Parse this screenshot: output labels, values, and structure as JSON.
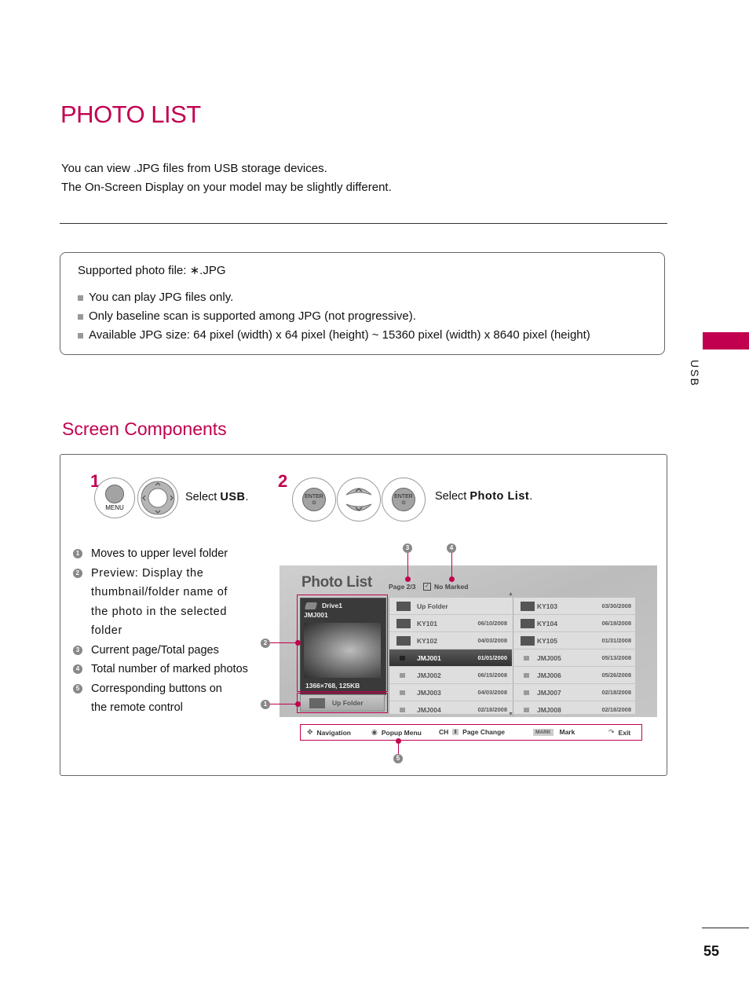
{
  "header": {
    "title": "PHOTO LIST",
    "intro": [
      "You can view .JPG files from USB storage devices.",
      "The On-Screen Display on your model may be slightly different."
    ]
  },
  "spec": {
    "title": "Supported photo file: ∗.JPG",
    "items": [
      "You can play JPG files only.",
      "Only baseline scan is supported among JPG (not progressive).",
      "Available JPG size: 64 pixel (width) x 64 pixel (height) ~ 15360 pixel (width) x 8640 pixel (height)"
    ]
  },
  "side_tab": {
    "label": "USB",
    "color": "#c1004f"
  },
  "section": {
    "title": "Screen Components"
  },
  "steps": [
    {
      "number": "1",
      "prefix": "Select ",
      "target": "USB",
      "suffix": ".",
      "buttons": [
        "MENU",
        "navigation-ring"
      ],
      "menu_label": "MENU"
    },
    {
      "number": "2",
      "prefix": "Select ",
      "target": "Photo List",
      "suffix": ".",
      "buttons": [
        "ENTER",
        "up-down-ring",
        "ENTER"
      ],
      "enter_label": "ENTER"
    }
  ],
  "legend": [
    {
      "num": "1",
      "text": "Moves to upper level folder"
    },
    {
      "num": "2",
      "text": "Preview: Display the thumbnail/folder name of the photo in the selected folder"
    },
    {
      "num": "3",
      "text": "Current page/Total pages"
    },
    {
      "num": "4",
      "text": "Total number of marked photos"
    },
    {
      "num": "5",
      "text": "Corresponding buttons on the remote control"
    }
  ],
  "screen": {
    "title": "Photo List",
    "page_info": "Page 2/3",
    "marked_info": "No Marked",
    "preview": {
      "drive": "Drive1",
      "file": "JMJ001",
      "info": "1366×768, 125KB"
    },
    "up_folder_button": "Up Folder",
    "left_column": [
      {
        "type": "up",
        "name": "Up Folder",
        "date": ""
      },
      {
        "type": "folder",
        "name": "KY101",
        "date": "06/10/2008"
      },
      {
        "type": "folder",
        "name": "KY102",
        "date": "04/03/2008"
      },
      {
        "type": "file",
        "name": "JMJ001",
        "date": "01/01/2000",
        "selected": true
      },
      {
        "type": "file",
        "name": "JMJ002",
        "date": "06/15/2008"
      },
      {
        "type": "file",
        "name": "JMJ003",
        "date": "04/03/2008"
      },
      {
        "type": "file",
        "name": "JMJ004",
        "date": "02/18/2008"
      }
    ],
    "right_column": [
      {
        "type": "folder",
        "name": "KY103",
        "date": "03/30/2008"
      },
      {
        "type": "folder",
        "name": "KY104",
        "date": "06/19/2008"
      },
      {
        "type": "folder",
        "name": "KY105",
        "date": "01/31/2008"
      },
      {
        "type": "file",
        "name": "JMJ005",
        "date": "05/13/2008"
      },
      {
        "type": "file",
        "name": "JMJ006",
        "date": "05/26/2008"
      },
      {
        "type": "file",
        "name": "JMJ007",
        "date": "02/18/2008"
      },
      {
        "type": "file",
        "name": "JMJ008",
        "date": "02/18/2008"
      }
    ],
    "nav_bar": {
      "navigation": "Navigation",
      "popup_menu": "Popup Menu",
      "ch_key": "CH",
      "page_change": "Page Change",
      "mark_key": "MARK",
      "mark": "Mark",
      "exit": "Exit"
    }
  },
  "callouts": [
    "1",
    "2",
    "3",
    "4",
    "5"
  ],
  "footer": {
    "page_number": "55"
  },
  "colors": {
    "accent": "#c1004f"
  }
}
